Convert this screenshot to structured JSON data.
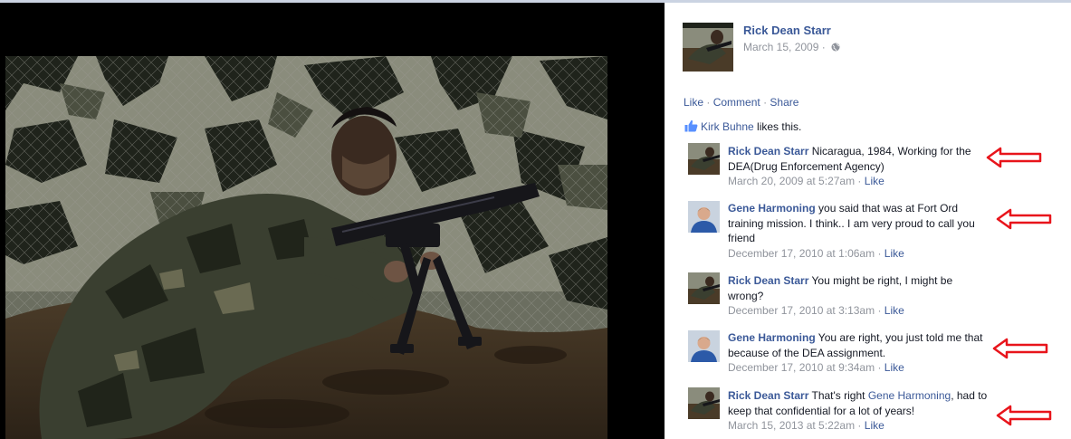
{
  "post": {
    "author": "Rick Dean Starr",
    "date": "March 15, 2009",
    "date_sep": "·",
    "privacy_icon": "globe-icon"
  },
  "actions": {
    "like": "Like",
    "comment": "Comment",
    "share": "Share",
    "sep": "·"
  },
  "likes": {
    "liker": "Kirk Buhne",
    "suffix": " likes this.",
    "icon": "thumbs-up-icon"
  },
  "comments": [
    {
      "name": "Rick Dean Starr",
      "text": " Nicaragua, 1984, Working for the DEA(Drug Enforcement Agency)",
      "time": "March 20, 2009 at 5:27am",
      "sep": " · ",
      "like": "Like"
    },
    {
      "name": "Gene Harmoning",
      "text": " you said that was at Fort Ord training mission. I think.. I am very proud to call you friend",
      "time": "December 17, 2010 at 1:06am",
      "sep": " · ",
      "like": "Like"
    },
    {
      "name": "Rick Dean Starr",
      "text": " You might be right, I might be wrong?",
      "time": "December 17, 2010 at 3:13am",
      "sep": " · ",
      "like": "Like"
    },
    {
      "name": "Gene Harmoning",
      "text": " You are right, you just told me that because of the DEA assignment.",
      "time": "December 17, 2010 at 9:34am",
      "sep": " · ",
      "like": "Like"
    },
    {
      "name": "Rick Dean Starr",
      "text_before": " That's right ",
      "mention": "Gene Harmoning",
      "text_after": ", had to keep that confidential for a lot of years!",
      "time": "March 15, 2013 at 5:22am",
      "sep": " · ",
      "like": "Like"
    }
  ],
  "colors": {
    "link": "#3b5998",
    "meta": "#90949c",
    "annotation_arrow": "#e8141b",
    "photo_bg": "#000000"
  }
}
